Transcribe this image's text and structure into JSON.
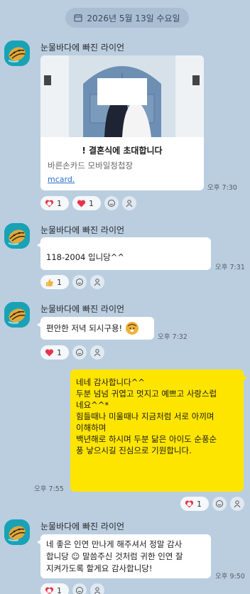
{
  "date_label": "2026년 5월 13일 수요일",
  "sender_name": "눈물바다에 빠진 라이언",
  "card": {
    "title": "! 결혼식에 초대합니다",
    "subtitle": "바른손카드 모바일청첩장",
    "link": "mcard."
  },
  "messages": {
    "m1": {
      "time": "오후 7:30",
      "reactions": [
        {
          "icon": "heart-face",
          "count": "1"
        },
        {
          "icon": "heart",
          "count": "1"
        }
      ]
    },
    "m2": {
      "text": "118-2004 입니당^^",
      "time": "오후 7:31",
      "reactions": [
        {
          "icon": "thumbs-up",
          "count": "1"
        }
      ]
    },
    "m3": {
      "text": "편안한 저녁 되시구용!",
      "time": "오후 7:32",
      "reactions": [
        {
          "icon": "heart",
          "count": "1"
        }
      ]
    },
    "m4": {
      "lines": [
        "네네 감사합니다^^",
        "두분 넘넘 귀엽고 멋지고 예쁘고 사랑스럽",
        "네요^^*",
        "힘들때나 미울때나 지금처럼 서로 아끼며",
        "이해하며",
        "백년해로 하시며 두분 닮은 아이도 순풍순",
        "풍 낳으시길 진심으로 기원합니다."
      ],
      "time": "오후 7:55",
      "reactions": [
        {
          "icon": "heart-face",
          "count": "1"
        }
      ]
    },
    "m5": {
      "lines": [
        "네 좋은 인연 만나게 해주셔서 정말 감사",
        "합니당 ☺ 말씀주신 것처럼 귀한 인연 잘",
        "지켜가도록 할게요 감사합니당!"
      ],
      "time": "오후 9:50",
      "reactions": [
        {
          "icon": "heart-face",
          "count": "1"
        }
      ]
    }
  },
  "colors": {
    "background": "#bacee0",
    "my_bubble": "#fee500",
    "their_bubble": "#ffffff",
    "heart": "#e8354a"
  }
}
